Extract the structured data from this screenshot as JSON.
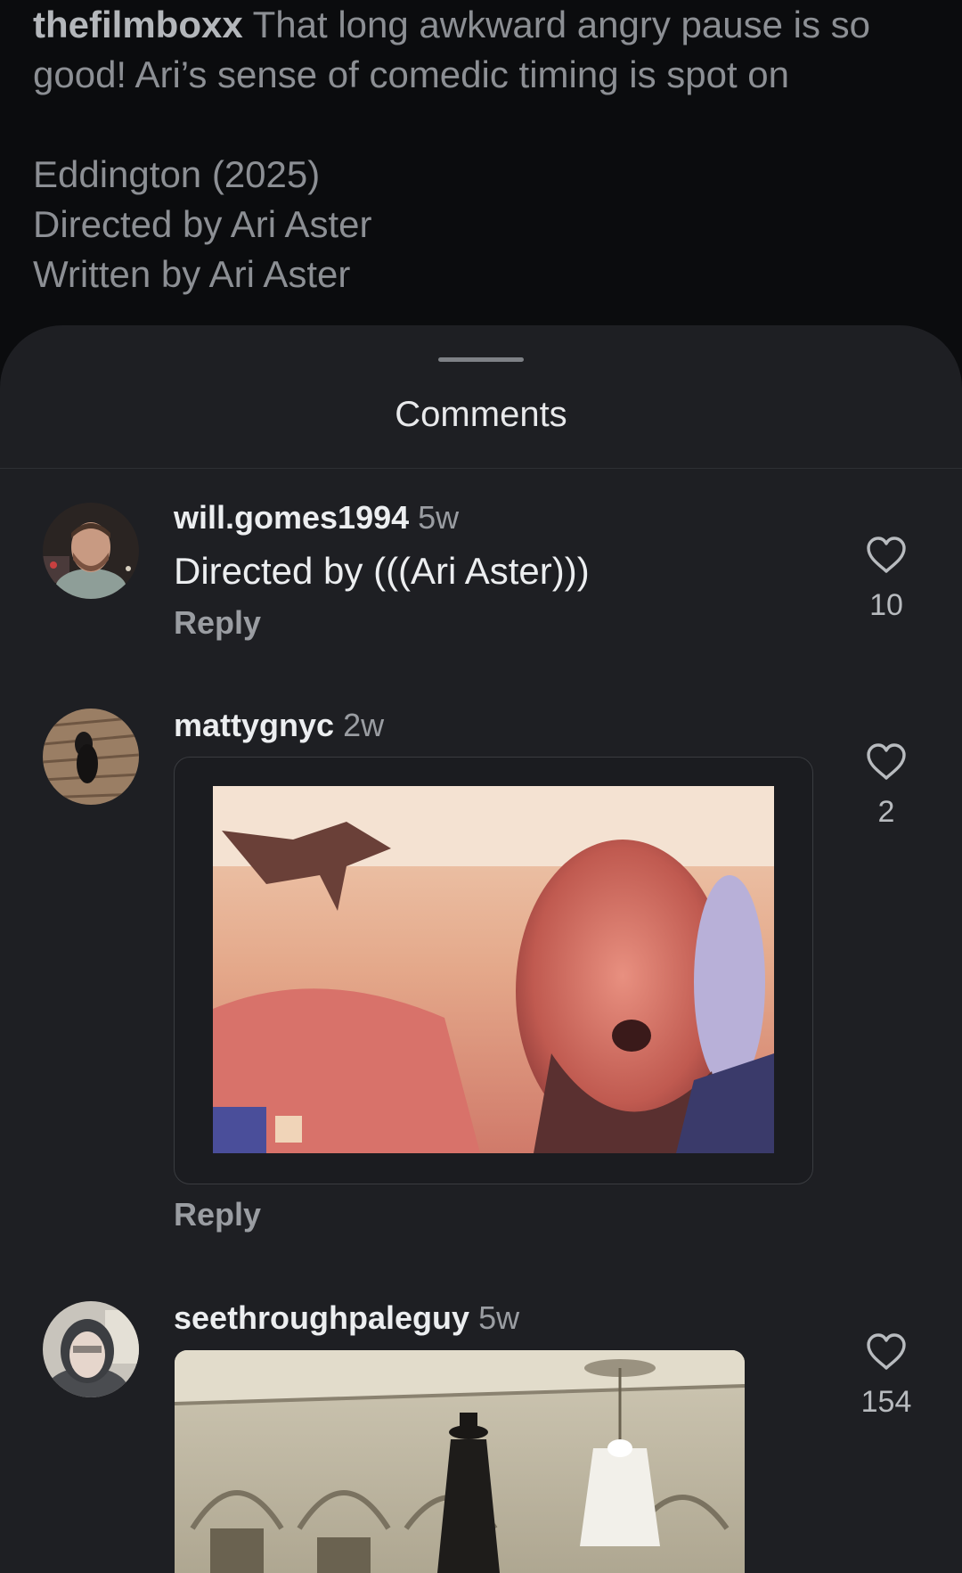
{
  "caption": {
    "username": "thefilmboxx",
    "text": "That long awkward angry pause is so good! Ari’s sense of comedic timing is spot on",
    "movie_line": "Eddington (2025)",
    "directed_line": "Directed by  Ari Aster",
    "written_line": "Written by  Ari Aster"
  },
  "sheet": {
    "title": "Comments"
  },
  "comments": [
    {
      "username": "will.gomes1994",
      "time": "5w",
      "text": "Directed by (((Ari Aster)))",
      "reply_label": "Reply",
      "likes": "10",
      "avatar_icon": "user-avatar-photo"
    },
    {
      "username": "mattygnyc",
      "time": "2w",
      "reply_label": "Reply",
      "likes": "2",
      "avatar_icon": "user-avatar-dog",
      "attachment": "gif"
    },
    {
      "username": "seethroughpaleguy",
      "time": "5w",
      "likes": "154",
      "avatar_icon": "user-avatar-hood",
      "attachment": "gif"
    }
  ],
  "icons": {
    "like": "heart-outline-icon"
  },
  "colors": {
    "background": "#0b0c0e",
    "sheet": "#1e1f23",
    "text_primary": "#eceef0",
    "text_secondary": "#9a9da2"
  }
}
